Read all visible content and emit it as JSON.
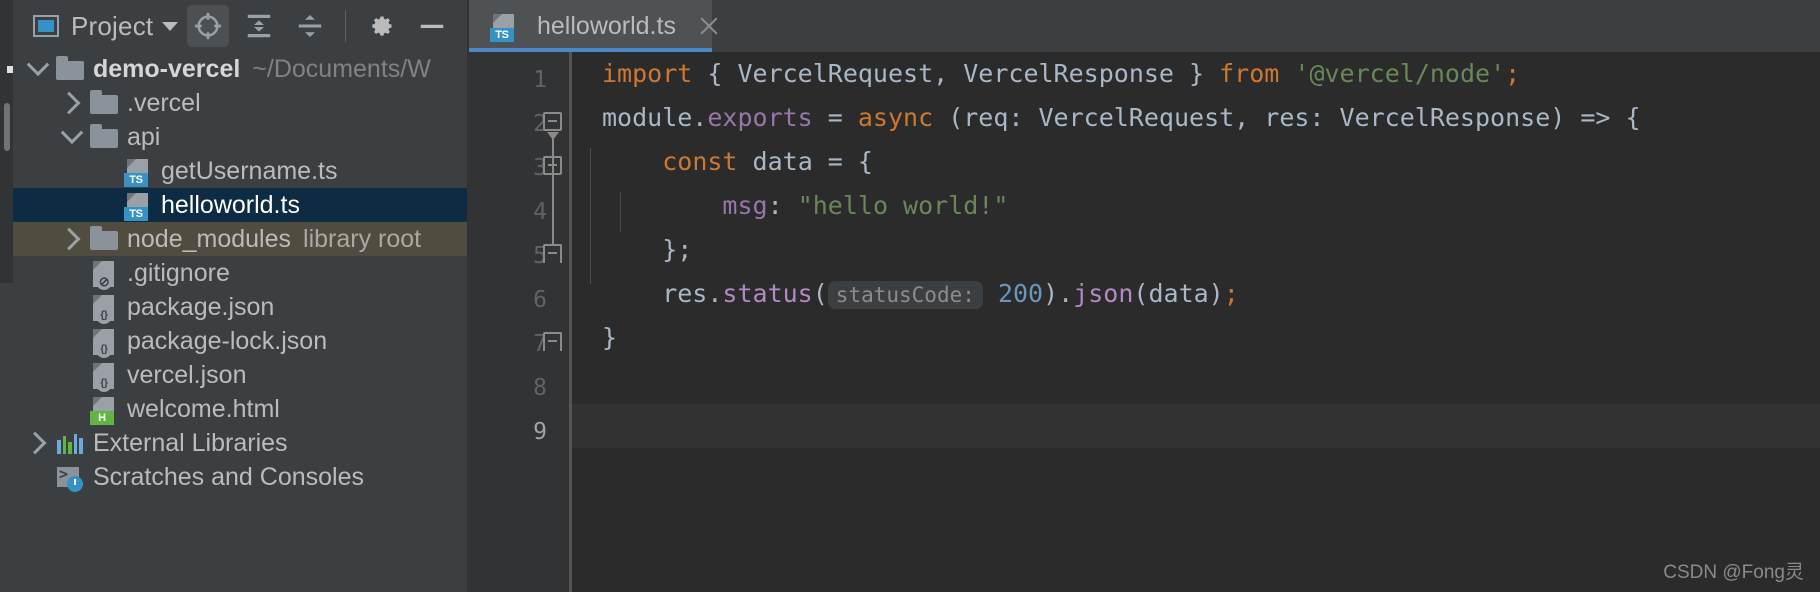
{
  "project_panel": {
    "title": "Project",
    "icons": {
      "panel": "project-window-icon",
      "dropdown": "chevron-down-icon",
      "locate": "locate-file-icon",
      "expand_all": "expand-all-icon",
      "collapse_all": "collapse-all-icon",
      "settings": "gear-icon",
      "hide": "minimize-icon"
    }
  },
  "tree": [
    {
      "label": "demo-vercel",
      "sub": "~/Documents/W",
      "icon": "folder-icon",
      "twisty": "open",
      "indent": 0,
      "bold": true,
      "state": "normal"
    },
    {
      "label": ".vercel",
      "sub": "",
      "icon": "folder-icon",
      "twisty": "closed",
      "indent": 1,
      "bold": false,
      "state": "normal"
    },
    {
      "label": "api",
      "sub": "",
      "icon": "folder-icon",
      "twisty": "open",
      "indent": 1,
      "bold": false,
      "state": "normal"
    },
    {
      "label": "getUsername.ts",
      "sub": "",
      "icon": "typescript-file-icon",
      "twisty": "none",
      "indent": 2,
      "bold": false,
      "state": "normal",
      "badge": "TS"
    },
    {
      "label": "helloworld.ts",
      "sub": "",
      "icon": "typescript-file-icon",
      "twisty": "none",
      "indent": 2,
      "bold": false,
      "state": "selected",
      "badge": "TS"
    },
    {
      "label": "node_modules",
      "sub": "library root",
      "icon": "folder-icon",
      "twisty": "closed",
      "indent": 1,
      "bold": false,
      "state": "library-root"
    },
    {
      "label": ".gitignore",
      "sub": "",
      "icon": "gitignore-file-icon",
      "twisty": "none",
      "indent": 1,
      "bold": false,
      "state": "normal",
      "badge": "ignore"
    },
    {
      "label": "package.json",
      "sub": "",
      "icon": "json-file-icon",
      "twisty": "none",
      "indent": 1,
      "bold": false,
      "state": "normal",
      "badge": "json"
    },
    {
      "label": "package-lock.json",
      "sub": "",
      "icon": "json-file-icon",
      "twisty": "none",
      "indent": 1,
      "bold": false,
      "state": "normal",
      "badge": "json"
    },
    {
      "label": "vercel.json",
      "sub": "",
      "icon": "json-file-icon",
      "twisty": "none",
      "indent": 1,
      "bold": false,
      "state": "normal",
      "badge": "json"
    },
    {
      "label": "welcome.html",
      "sub": "",
      "icon": "html-file-icon",
      "twisty": "none",
      "indent": 1,
      "bold": false,
      "state": "normal",
      "badge": "H"
    },
    {
      "label": "External Libraries",
      "sub": "",
      "icon": "external-libraries-icon",
      "twisty": "closed",
      "indent": 0,
      "bold": false,
      "state": "normal"
    },
    {
      "label": "Scratches and Consoles",
      "sub": "",
      "icon": "scratches-icon",
      "twisty": "none",
      "indent": 0,
      "bold": false,
      "state": "normal"
    }
  ],
  "editor": {
    "tab": {
      "label": "helloworld.ts",
      "icon": "typescript-file-icon",
      "badge": "TS",
      "close_icon": "close-icon",
      "active": true
    },
    "line_numbers": [
      "1",
      "2",
      "3",
      "4",
      "5",
      "6",
      "7",
      "8",
      "9"
    ],
    "current_line": 9,
    "lines": [
      [
        {
          "t": "import",
          "c": "kw"
        },
        {
          "t": " { ",
          "c": "pun"
        },
        {
          "t": "VercelRequest",
          "c": "pun"
        },
        {
          "t": ", ",
          "c": "pun"
        },
        {
          "t": "VercelResponse",
          "c": "pun"
        },
        {
          "t": " } ",
          "c": "pun"
        },
        {
          "t": "from",
          "c": "kw"
        },
        {
          "t": " ",
          "c": "pun"
        },
        {
          "t": "'@vercel/node'",
          "c": "str"
        },
        {
          "t": ";",
          "c": "semi"
        }
      ],
      [
        {
          "t": "module.",
          "c": "pun"
        },
        {
          "t": "exports",
          "c": "prop"
        },
        {
          "t": " = ",
          "c": "pun"
        },
        {
          "t": "async",
          "c": "kw"
        },
        {
          "t": " (req: VercelRequest, res: VercelResponse) => {",
          "c": "pun"
        }
      ],
      [
        {
          "t": "    ",
          "c": "pun"
        },
        {
          "t": "const",
          "c": "kw"
        },
        {
          "t": " data = {",
          "c": "pun"
        }
      ],
      [
        {
          "t": "        ",
          "c": "pun"
        },
        {
          "t": "msg",
          "c": "prop"
        },
        {
          "t": ": ",
          "c": "pun"
        },
        {
          "t": "\"hello world!\"",
          "c": "str"
        }
      ],
      [
        {
          "t": "    };",
          "c": "pun"
        }
      ],
      [
        {
          "t": "    res.",
          "c": "pun"
        },
        {
          "t": "status",
          "c": "fn"
        },
        {
          "t": "(",
          "c": "pun"
        },
        {
          "t": "statusCode:",
          "c": "inlay"
        },
        {
          "t": " ",
          "c": "pun"
        },
        {
          "t": "200",
          "c": "num"
        },
        {
          "t": ").",
          "c": "pun"
        },
        {
          "t": "json",
          "c": "fn"
        },
        {
          "t": "(data)",
          "c": "pun"
        },
        {
          "t": ";",
          "c": "semi"
        }
      ],
      [
        {
          "t": "}",
          "c": "pun"
        }
      ],
      [],
      []
    ]
  },
  "watermark": "CSDN @Fong灵",
  "colors": {
    "panel_bg": "#3c3f41",
    "editor_bg": "#2b2b2b",
    "gutter_bg": "#313335",
    "selection": "#0d2b42",
    "library_root": "#514c40",
    "tab_active": "#4e5254",
    "tab_underline": "#4a88c7",
    "keyword": "#cc7832",
    "string": "#6a8759",
    "number": "#6897bb",
    "property": "#9876aa",
    "function": "#b389c5",
    "default_text": "#a9b7c6",
    "ts_badge": "#3592c4",
    "html_badge": "#62b543",
    "caret_row": "#323232"
  }
}
